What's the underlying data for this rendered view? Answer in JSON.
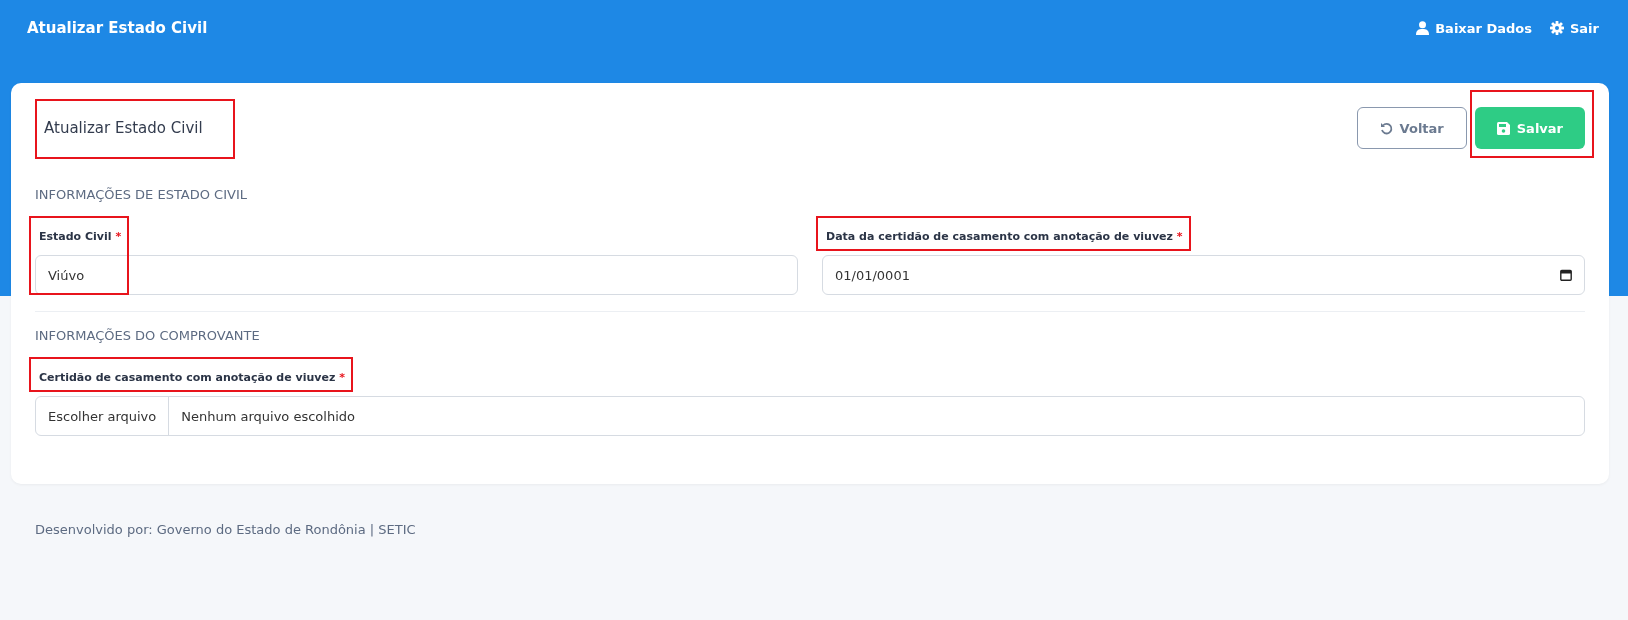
{
  "header": {
    "title": "Atualizar Estado Civil",
    "links": [
      {
        "label": "Baixar Dados",
        "kind": "user"
      },
      {
        "label": "Sair",
        "kind": "gear"
      }
    ]
  },
  "card": {
    "title": "Atualizar Estado Civil",
    "title_highlighted": true,
    "buttons": [
      {
        "label": "Voltar",
        "kind": "back",
        "highlighted": false
      },
      {
        "label": "Salvar",
        "kind": "save",
        "highlighted": true
      }
    ],
    "sections": [
      {
        "heading": "INFORMAÇÕES DE ESTADO CIVIL",
        "fields": [
          {
            "label": "Estado Civil",
            "required_mark": "*",
            "kind": "text",
            "value": "Viúvo",
            "highlighted": true
          },
          {
            "label": "Data da certidão de casamento com anotação de viuvez",
            "required_mark": "*",
            "kind": "date",
            "value": "01/01/0001",
            "highlighted": true
          }
        ]
      },
      {
        "heading": "INFORMAÇÕES DO COMPROVANTE",
        "fields": [
          {
            "label": "Certidão de casamento com anotação de viuvez",
            "required_mark": "*",
            "kind": "file",
            "button": "Escolher arquivo",
            "value": "Nenhum arquivo escolhido",
            "highlighted": true
          }
        ]
      }
    ]
  },
  "footer": "Desenvolvido por: Governo do Estado de Rondônia | SETIC"
}
